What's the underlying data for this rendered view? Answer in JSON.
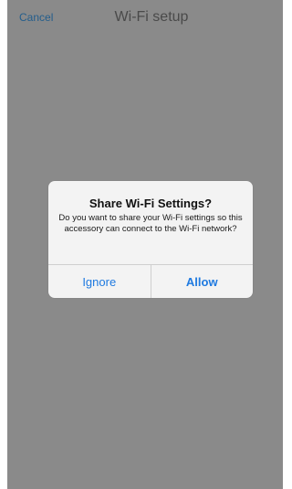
{
  "navbar": {
    "cancel_label": "Cancel",
    "title": "Wi-Fi setup"
  },
  "alert": {
    "title": "Share Wi-Fi Settings?",
    "message": "Do you want to share your Wi-Fi settings so this accessory can connect to the Wi-Fi network?",
    "ignore_label": "Ignore",
    "allow_label": "Allow"
  },
  "colors": {
    "overlay": "#8a8a8a",
    "accent": "#1f7ae0",
    "cancel_link": "#245e8c"
  }
}
